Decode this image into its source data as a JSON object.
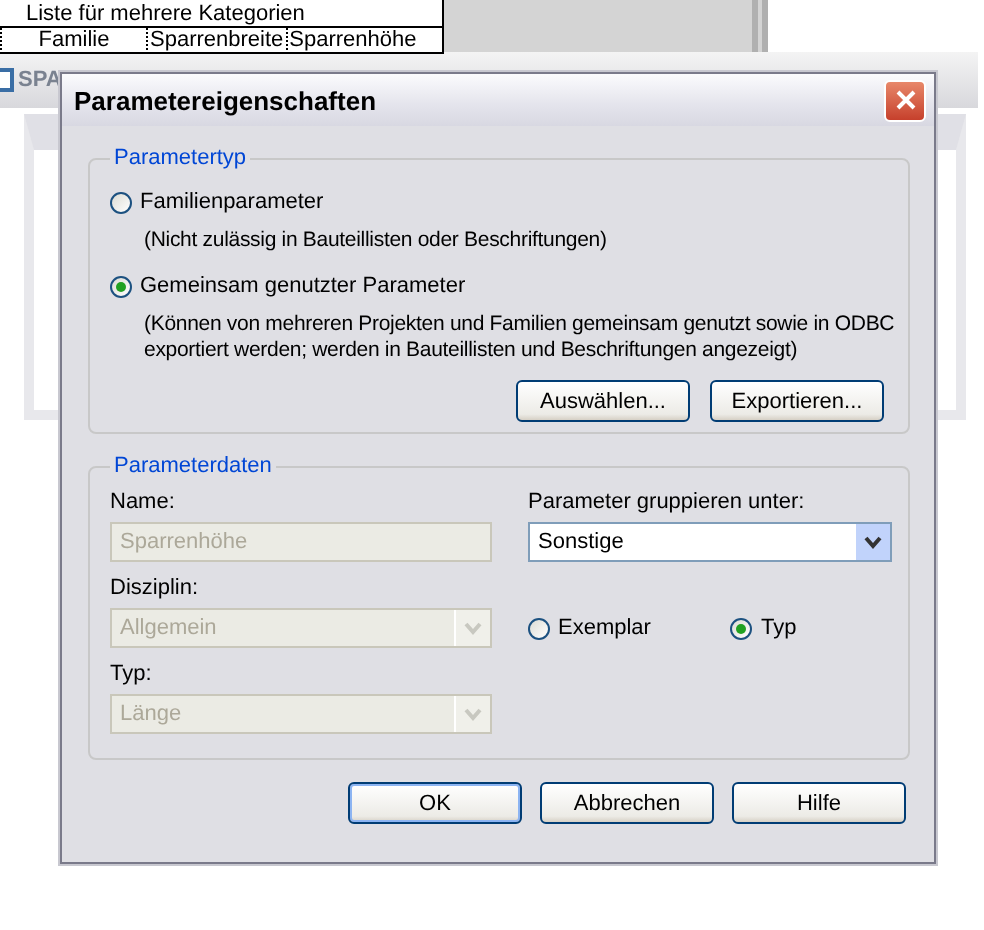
{
  "background": {
    "sheet": {
      "title": "Liste für mehrere Kategorien",
      "columns": [
        "Familie",
        "Sparrenbreite",
        "Sparrenhöhe"
      ]
    },
    "window_title": "SPA"
  },
  "dialog": {
    "title": "Parametereigenschaften",
    "parameter_type": {
      "legend": "Parametertyp",
      "options": [
        {
          "label": "Familienparameter",
          "note": "(Nicht zulässig in Bauteillisten oder Beschriftungen)",
          "selected": false
        },
        {
          "label": "Gemeinsam genutzter Parameter",
          "note": "(Können von mehreren Projekten und Familien gemeinsam genutzt sowie in ODBC exportiert werden; werden in Bauteillisten und Beschriftungen angezeigt)",
          "selected": true
        }
      ],
      "buttons": [
        "Auswählen...",
        "Exportieren..."
      ]
    },
    "parameter_data": {
      "legend": "Parameterdaten",
      "name": {
        "label": "Name:",
        "value": "Sparrenhöhe",
        "disabled": true
      },
      "group_under": {
        "label": "Parameter gruppieren unter:",
        "value": "Sonstige",
        "disabled": false
      },
      "discipline": {
        "label": "Disziplin:",
        "value": "Allgemein",
        "disabled": true
      },
      "type": {
        "label": "Typ:",
        "value": "Länge",
        "disabled": true
      },
      "scope": [
        {
          "label": "Exemplar",
          "selected": false
        },
        {
          "label": "Typ",
          "selected": true
        }
      ]
    },
    "buttons": [
      {
        "label": "OK",
        "default": true
      },
      {
        "label": "Abbrechen",
        "default": false
      },
      {
        "label": "Hilfe",
        "default": false
      }
    ]
  }
}
